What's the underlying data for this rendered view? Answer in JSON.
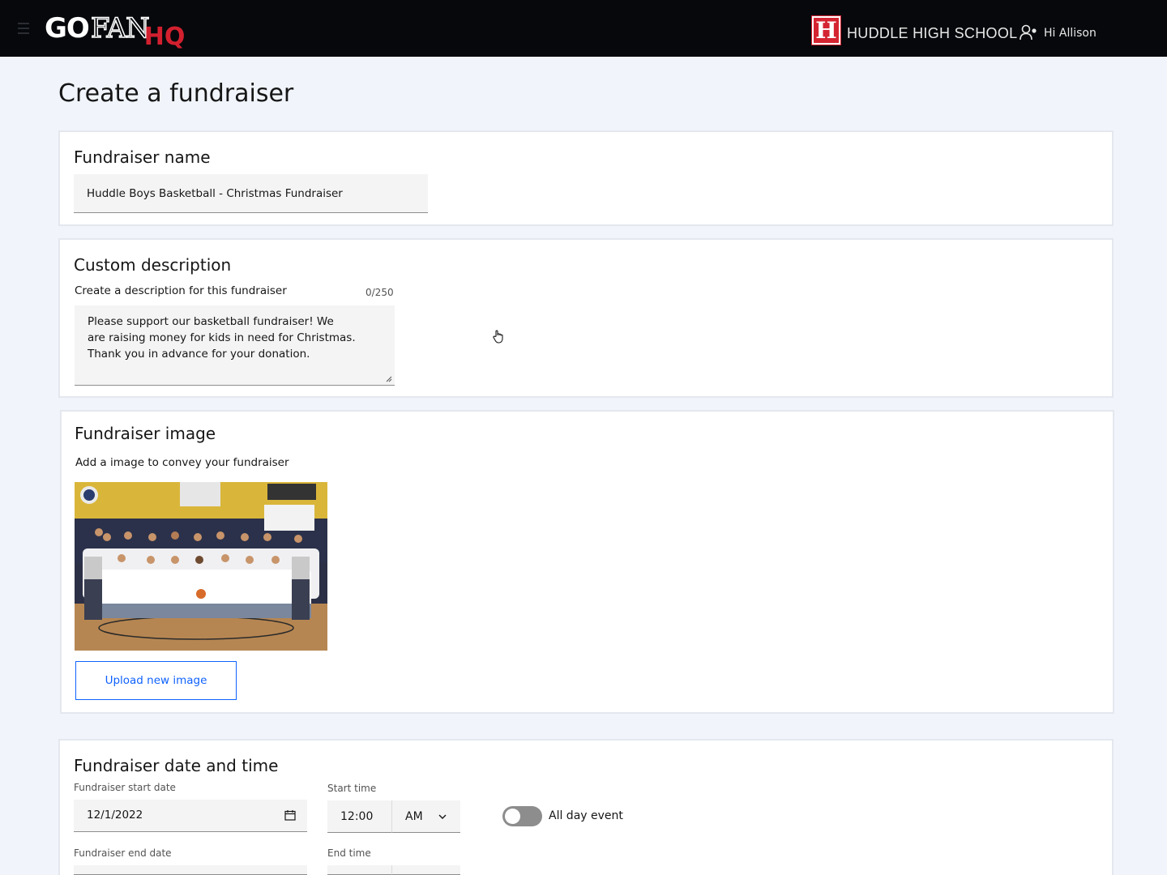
{
  "header": {
    "brand": {
      "go": "GO",
      "fan": "FAN",
      "hq": "HQ"
    },
    "school_initial": "H",
    "school_name": "HUDDLE HIGH SCHOOL",
    "greeting": "Hi Allison"
  },
  "page": {
    "title": "Create a fundraiser"
  },
  "name_section": {
    "title": "Fundraiser name",
    "value": "Huddle Boys Basketball - Christmas Fundraiser"
  },
  "description_section": {
    "title": "Custom description",
    "helper": "Create a description for this fundraiser",
    "counter": "0/250",
    "lines": [
      "Please support our basketball fundraiser! We",
      "are raising money for kids in need for Christmas.",
      "Thank you in advance for your donation."
    ]
  },
  "image_section": {
    "title": "Fundraiser image",
    "helper": "Add a image to convey your fundraiser",
    "upload_label": "Upload new image"
  },
  "datetime_section": {
    "title": "Fundraiser date and time",
    "start_date_label": "Fundraiser start date",
    "start_date": "12/1/2022",
    "start_time_label": "Start time",
    "start_time": "12:00",
    "start_period": "AM",
    "all_day_label": "All day event",
    "all_day_enabled": false,
    "end_date_label": "Fundraiser end date",
    "end_time_label": "End time"
  },
  "colors": {
    "header_bg": "#06080c",
    "brand_red": "#d2202f",
    "primary_blue": "#0f62fe",
    "page_bg": "#f1f5fb"
  },
  "icons": [
    "menu-icon",
    "user-icon",
    "calendar-icon",
    "chevron-down-icon",
    "pointer-hand-icon"
  ]
}
